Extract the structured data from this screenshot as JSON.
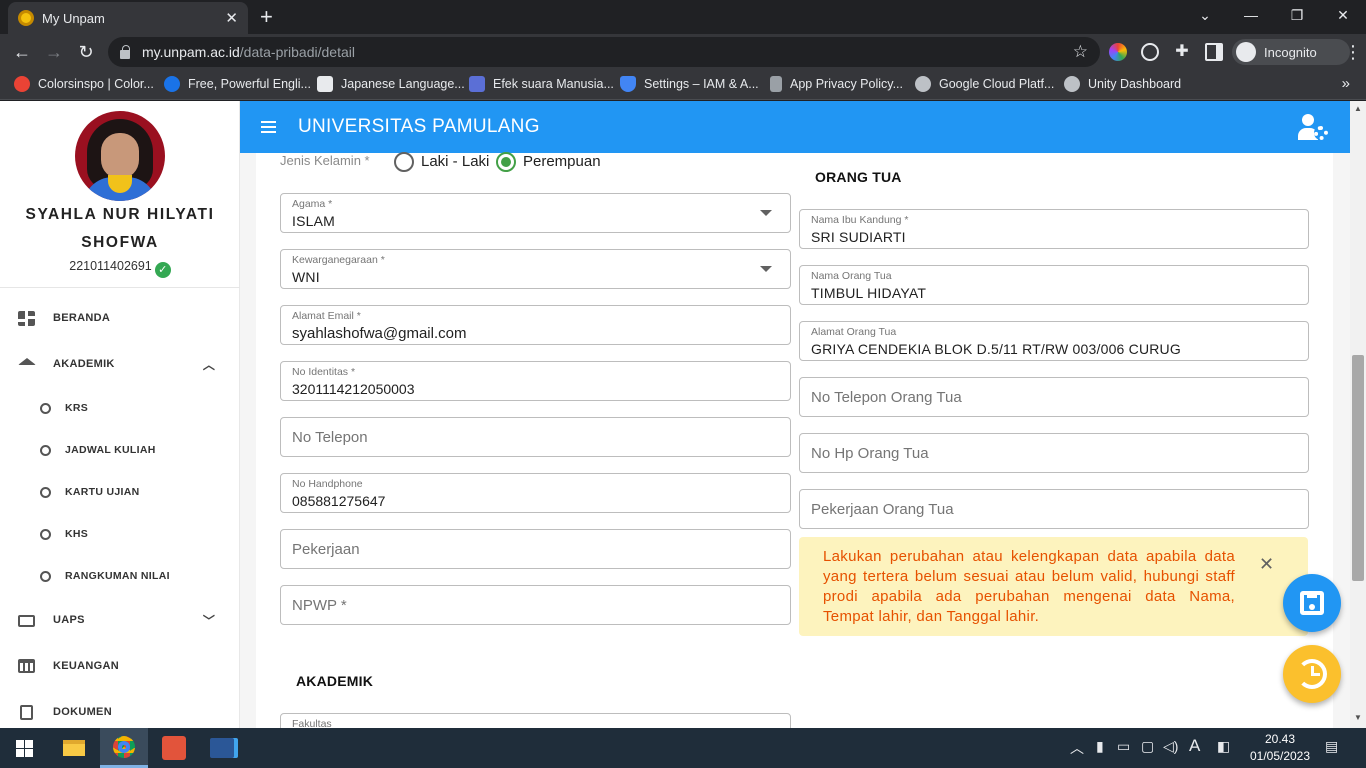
{
  "browser": {
    "tab_title": "My Unpam",
    "url_host": "my.unpam.ac.id",
    "url_path": "/data-pribadi/detail",
    "profile_label": "Incognito",
    "bookmarks": [
      {
        "label": "Colorsinspo | Color...",
        "color": "#ea4335"
      },
      {
        "label": "Free, Powerful Engli...",
        "color": "#1a73e8"
      },
      {
        "label": "Japanese Language...",
        "color": "#3c4043"
      },
      {
        "label": "Efek suara Manusia...",
        "color": "#5b6fd6"
      },
      {
        "label": "Settings – IAM & A...",
        "color": "#4285f4"
      },
      {
        "label": "App Privacy Policy...",
        "color": "#9aa0a6"
      },
      {
        "label": "Google Cloud Platf...",
        "color": "#9aa0a6"
      },
      {
        "label": "Unity Dashboard",
        "color": "#9aa0a6"
      }
    ]
  },
  "sidebar": {
    "name_line1": "SYAHLA NUR HILYATI",
    "name_line2": "SHOFWA",
    "nim": "221011402691",
    "nav": [
      {
        "label": "BERANDA"
      },
      {
        "label": "AKADEMIK"
      },
      {
        "label": "UAPS"
      },
      {
        "label": "KEUANGAN"
      },
      {
        "label": "DOKUMEN"
      }
    ],
    "akademik_sub": [
      "KRS",
      "JADWAL KULIAH",
      "KARTU UJIAN",
      "KHS",
      "RANGKUMAN NILAI"
    ]
  },
  "appbar": {
    "title": "UNIVERSITAS PAMULANG"
  },
  "form": {
    "gender": {
      "label": "Jenis Kelamin *",
      "options": [
        "Laki - Laki",
        "Perempuan"
      ],
      "selected": "Perempuan"
    },
    "agama": {
      "label": "Agama *",
      "value": "ISLAM"
    },
    "kewarganegaraan": {
      "label": "Kewarganegaraan *",
      "value": "WNI"
    },
    "email": {
      "label": "Alamat Email *",
      "value": "syahlashofwa@gmail.com"
    },
    "no_identitas": {
      "label": "No Identitas *",
      "value": "3201114212050003"
    },
    "no_telepon": {
      "placeholder": "No Telepon"
    },
    "no_handphone": {
      "label": "No Handphone",
      "value": "085881275647"
    },
    "pekerjaan": {
      "placeholder": "Pekerjaan"
    },
    "npwp": {
      "placeholder": "NPWP *"
    },
    "akademik_heading": "AKADEMIK",
    "fakultas": {
      "label": "Fakultas"
    }
  },
  "orang_tua": {
    "heading": "ORANG TUA",
    "nama_ibu": {
      "label": "Nama Ibu Kandung *",
      "value": "SRI SUDIARTI"
    },
    "nama_ortu": {
      "label": "Nama Orang Tua",
      "value": "TIMBUL HIDAYAT"
    },
    "alamat_ortu": {
      "label": "Alamat Orang Tua",
      "value": "GRIYA CENDEKIA BLOK D.5/11 RT/RW 003/006 CURUG"
    },
    "telepon_ortu": {
      "placeholder": "No Telepon Orang Tua"
    },
    "hp_ortu": {
      "placeholder": "No Hp Orang Tua"
    },
    "pekerjaan_ortu": {
      "placeholder": "Pekerjaan Orang Tua"
    }
  },
  "alert": {
    "text": "Lakukan perubahan atau kelengkapan data apabila data yang tertera belum sesuai atau belum valid, hubungi staff prodi apabila ada perubahan mengenai data Nama, Tempat lahir, dan Tanggal lahir."
  },
  "taskbar": {
    "time": "20.43",
    "date": "01/05/2023"
  },
  "colors": {
    "appbar": "#2196f3",
    "radio_selected": "#43a047",
    "alert_bg": "#fdf3be",
    "alert_text": "#e65100",
    "fab_save": "#2196f3",
    "fab_history": "#fbc02d"
  }
}
